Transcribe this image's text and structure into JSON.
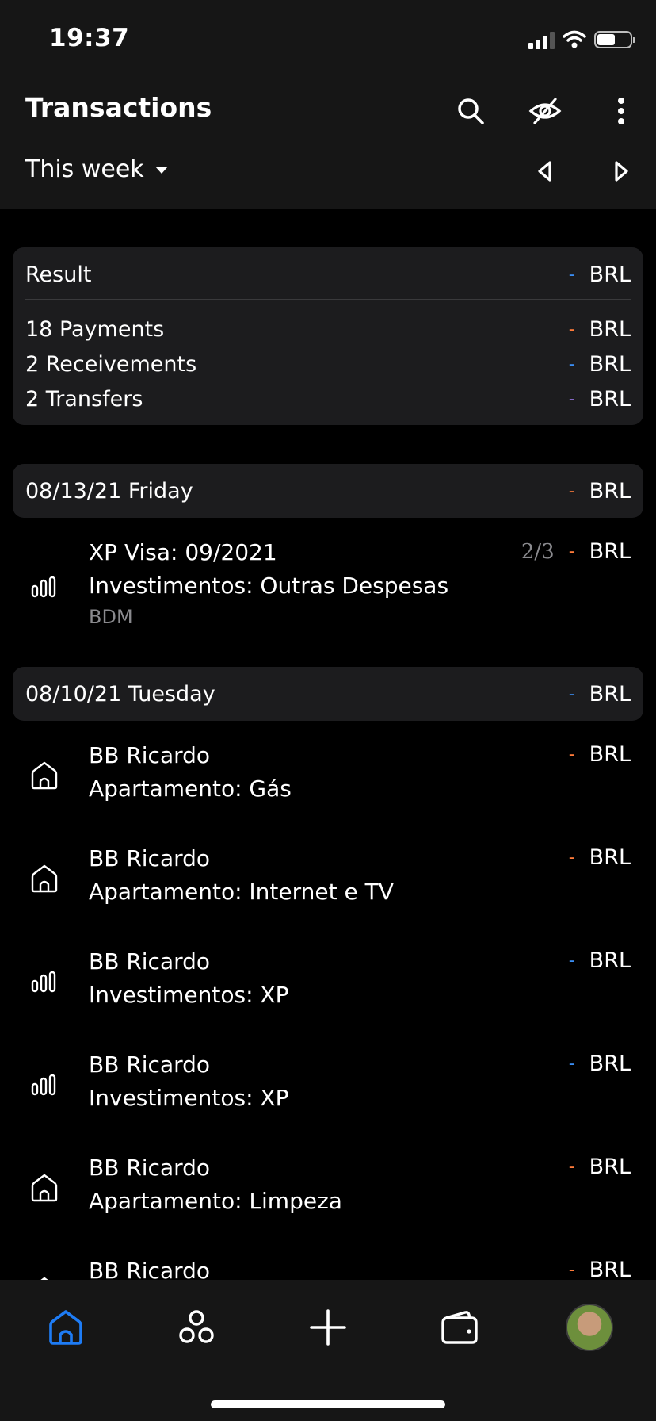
{
  "status": {
    "time": "19:37"
  },
  "header": {
    "title": "Transactions",
    "period": "This week"
  },
  "summary": {
    "result": {
      "label": "Result",
      "currency": "BRL",
      "dash": "-",
      "color": "#3b8ef5"
    },
    "rows": [
      {
        "label": "18 Payments",
        "dash": "-",
        "currency": "BRL",
        "color": "#ff7b3a"
      },
      {
        "label": "2 Receivements",
        "dash": "-",
        "currency": "BRL",
        "color": "#3b8ef5"
      },
      {
        "label": "2 Transfers",
        "dash": "-",
        "currency": "BRL",
        "color": "#9f7cf0"
      }
    ]
  },
  "groups": [
    {
      "date": "08/13/21 Friday",
      "dash": "-",
      "currency": "BRL",
      "color": "#ff7b3a",
      "items": [
        {
          "icon": "chart-bars-icon",
          "account": "XP Visa: 09/2021",
          "category": "Investimentos: Outras Despesas",
          "note": "BDM",
          "installment": "2/3",
          "dash": "-",
          "currency": "BRL",
          "color": "#ff7b3a"
        }
      ]
    },
    {
      "date": "08/10/21 Tuesday",
      "dash": "-",
      "currency": "BRL",
      "color": "#3b8ef5",
      "items": [
        {
          "icon": "house-icon",
          "account": "BB Ricardo",
          "category": "Apartamento: Gás",
          "dash": "-",
          "currency": "BRL",
          "color": "#ff7b3a"
        },
        {
          "icon": "house-icon",
          "account": "BB Ricardo",
          "category": "Apartamento: Internet e TV",
          "dash": "-",
          "currency": "BRL",
          "color": "#ff7b3a"
        },
        {
          "icon": "chart-bars-icon",
          "account": "BB Ricardo",
          "category": "Investimentos: XP",
          "dash": "-",
          "currency": "BRL",
          "color": "#3b8ef5"
        },
        {
          "icon": "chart-bars-icon",
          "account": "BB Ricardo",
          "category": "Investimentos: XP",
          "dash": "-",
          "currency": "BRL",
          "color": "#3b8ef5"
        },
        {
          "icon": "house-icon",
          "account": "BB Ricardo",
          "category": "Apartamento: Limpeza",
          "dash": "-",
          "currency": "BRL",
          "color": "#ff7b3a"
        },
        {
          "icon": "house-icon",
          "account": "BB Ricardo",
          "category": "",
          "dash": "-",
          "currency": "BRL",
          "color": "#ff7b3a"
        }
      ]
    }
  ],
  "tabbar": {
    "active_color": "#1e7cf5",
    "tabs": [
      "home-icon",
      "categories-icon",
      "add-icon",
      "wallet-icon",
      "avatar"
    ]
  }
}
